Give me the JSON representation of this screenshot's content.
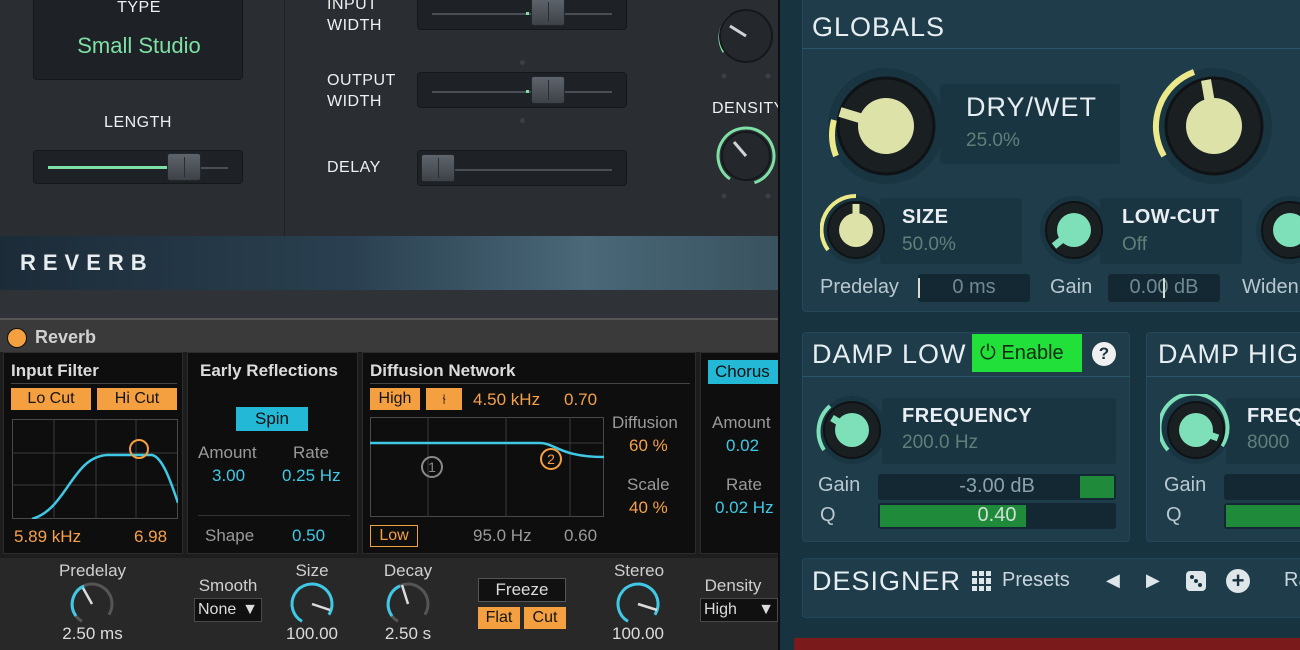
{
  "top_plugin": {
    "type_label": "TYPE",
    "type_value": "Small Studio",
    "length_label": "LENGTH",
    "input_width_label": "INPUT\nWIDTH",
    "output_width_label": "OUTPUT\nWIDTH",
    "delay_label": "DELAY",
    "density_label": "DENSITY",
    "reverb_banner": "REVERB",
    "length_level": 0.7,
    "input_width_level": 0.65,
    "output_width_level": 0.65,
    "delay_level": 0.0
  },
  "ableton": {
    "device_title": "Reverb",
    "input_filter": {
      "title": "Input Filter",
      "lo_cut": "Lo Cut",
      "hi_cut": "Hi Cut",
      "freq": "5.89 kHz",
      "width": "6.98"
    },
    "early_reflections": {
      "title": "Early Reflections",
      "spin": "Spin",
      "amount_label": "Amount",
      "amount_value": "3.00",
      "rate_label": "Rate",
      "rate_value": "0.25 Hz",
      "shape_label": "Shape",
      "shape_value": "0.50"
    },
    "diffusion_network": {
      "title": "Diffusion Network",
      "high": "High",
      "high_freq": "4.50 kHz",
      "high_val": "0.70",
      "diffusion_label": "Diffusion",
      "diffusion_value": "60 %",
      "scale_label": "Scale",
      "scale_value": "40 %",
      "low": "Low",
      "low_freq": "95.0 Hz",
      "low_val": "0.60",
      "node1": "1",
      "node2": "2"
    },
    "chorus": {
      "title": "Chorus",
      "amount_label": "Amount",
      "amount_value": "0.02",
      "rate_label": "Rate",
      "rate_value": "0.02 Hz"
    },
    "bottom": {
      "predelay_label": "Predelay",
      "predelay_value": "2.50 ms",
      "smooth_label": "Smooth",
      "smooth_value": "None",
      "size_label": "Size",
      "size_value": "100.00",
      "decay_label": "Decay",
      "decay_value": "2.50 s",
      "freeze": "Freeze",
      "flat": "Flat",
      "cut": "Cut",
      "stereo_label": "Stereo",
      "stereo_value": "100.00",
      "density_label": "Density",
      "density_value": "High"
    }
  },
  "melda": {
    "globals_title": "GLOBALS",
    "drywet_label": "DRY/WET",
    "drywet_value": "25.0%",
    "size_label": "SIZE",
    "size_value": "50.0%",
    "lowcut_label": "LOW-CUT",
    "lowcut_value": "Off",
    "predelay_label": "Predelay",
    "predelay_value": "0 ms",
    "gain_label": "Gain",
    "gain_value": "0.00 dB",
    "widen_label": "Widen",
    "damp_low_title": "DAMP LOW",
    "enable_label": "Enable",
    "help": "?",
    "frequency_label": "FREQUENCY",
    "frequency_value": "200.0 Hz",
    "dl_gain_label": "Gain",
    "dl_gain_value": "-3.00 dB",
    "dl_q_label": "Q",
    "dl_q_value": "0.40",
    "damp_high_title": "DAMP HIGH",
    "dh_freq_label": "FREQ",
    "dh_freq_value": "8000",
    "dh_gain_label": "Gain",
    "dh_q_label": "Q",
    "designer_title": "DESIGNER",
    "presets_label": "Presets",
    "cut_text": "Ra"
  },
  "colors": {
    "mint": "#7ee0a4",
    "cyan": "#3fc9e6",
    "orange": "#f5a040",
    "enable_green": "#22e03a",
    "knob_cream": "#dde2a8"
  }
}
